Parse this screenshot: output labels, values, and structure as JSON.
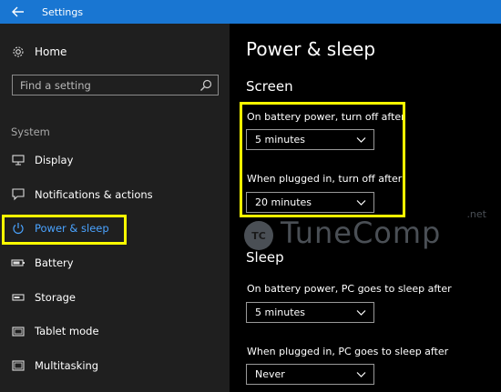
{
  "window": {
    "title": "Settings",
    "back_icon": "back-arrow-icon"
  },
  "sidebar": {
    "home_label": "Home",
    "search_placeholder": "Find a setting",
    "section_label": "System",
    "items": [
      {
        "label": "Display",
        "icon": "display-icon"
      },
      {
        "label": "Notifications & actions",
        "icon": "notifications-icon"
      },
      {
        "label": "Power & sleep",
        "icon": "power-icon",
        "active": true
      },
      {
        "label": "Battery",
        "icon": "battery-icon"
      },
      {
        "label": "Storage",
        "icon": "storage-icon"
      },
      {
        "label": "Tablet mode",
        "icon": "tablet-icon"
      },
      {
        "label": "Multitasking",
        "icon": "multitasking-icon"
      }
    ]
  },
  "main": {
    "title": "Power & sleep",
    "screen": {
      "heading": "Screen",
      "battery_label": "On battery power, turn off after",
      "battery_value": "5 minutes",
      "plugged_label": "When plugged in, turn off after",
      "plugged_value": "20 minutes"
    },
    "sleep": {
      "heading": "Sleep",
      "battery_label": "On battery power, PC goes to sleep after",
      "battery_value": "5 minutes",
      "plugged_label": "When plugged in, PC goes to sleep after",
      "plugged_value": "Never"
    }
  },
  "watermark": {
    "badge": "TC",
    "text": "TuneComp",
    "suffix": ".net"
  },
  "colors": {
    "titlebar": "#1976d2",
    "sidebar_bg": "#1f1f1f",
    "main_bg": "#000000",
    "accent": "#4aa3ff",
    "highlight": "#ffff00"
  }
}
